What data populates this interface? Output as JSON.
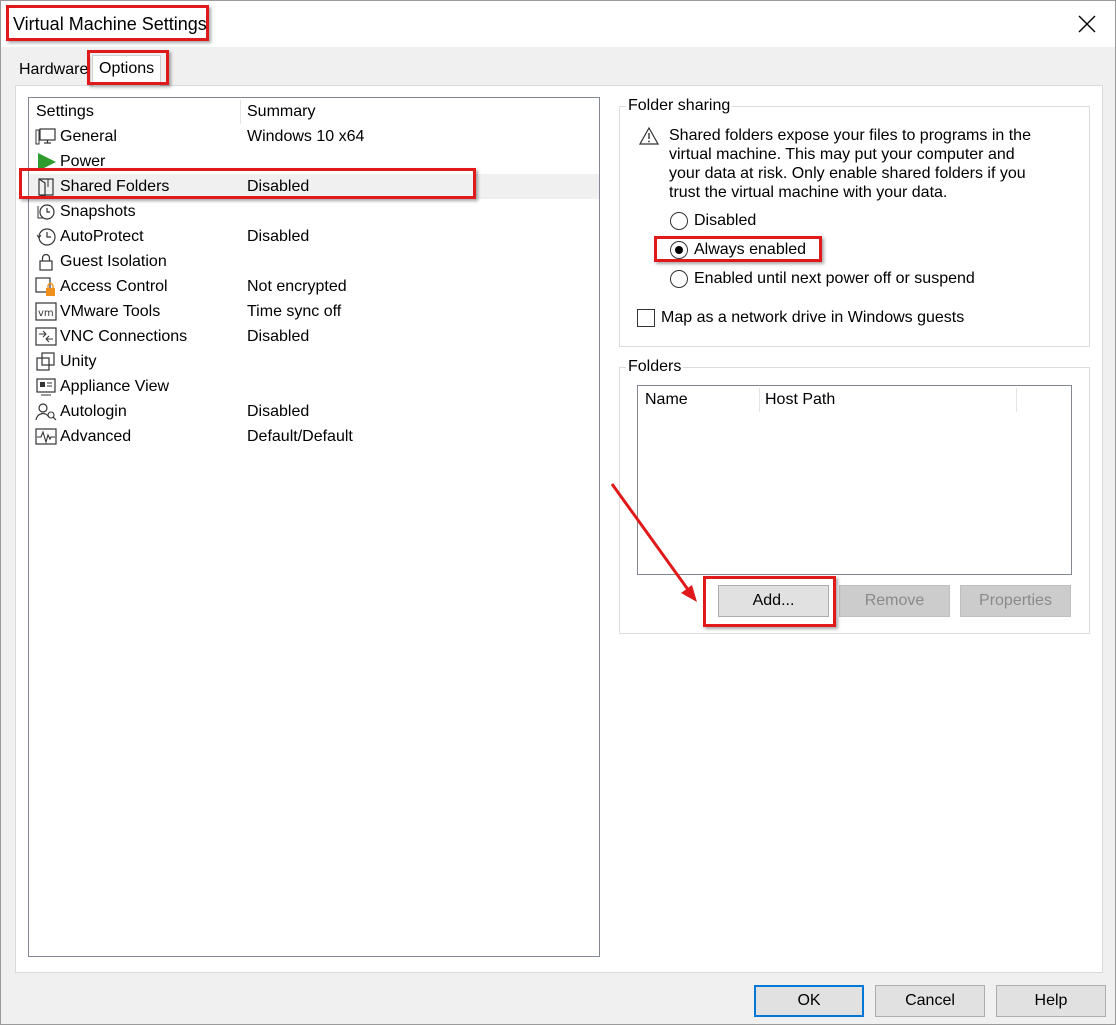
{
  "window": {
    "title": "Virtual Machine Settings"
  },
  "tabs": [
    {
      "label": "Hardware",
      "selected": false
    },
    {
      "label": "Options",
      "selected": true
    }
  ],
  "settings_list": {
    "columns": [
      "Settings",
      "Summary"
    ],
    "rows": [
      {
        "icon": "monitor-icon",
        "label": "General",
        "summary": "Windows 10 x64"
      },
      {
        "icon": "play-icon",
        "label": "Power",
        "summary": ""
      },
      {
        "icon": "shared-folder-icon",
        "label": "Shared Folders",
        "summary": "Disabled",
        "selected": true
      },
      {
        "icon": "snapshot-clock-icon",
        "label": "Snapshots",
        "summary": ""
      },
      {
        "icon": "history-icon",
        "label": "AutoProtect",
        "summary": "Disabled"
      },
      {
        "icon": "lock-icon",
        "label": "Guest Isolation",
        "summary": ""
      },
      {
        "icon": "access-control-icon",
        "label": "Access Control",
        "summary": "Not encrypted"
      },
      {
        "icon": "vm-icon",
        "label": "VMware Tools",
        "summary": "Time sync off"
      },
      {
        "icon": "vnc-icon",
        "label": "VNC Connections",
        "summary": "Disabled"
      },
      {
        "icon": "unity-icon",
        "label": "Unity",
        "summary": ""
      },
      {
        "icon": "appliance-icon",
        "label": "Appliance View",
        "summary": ""
      },
      {
        "icon": "autologin-icon",
        "label": "Autologin",
        "summary": "Disabled"
      },
      {
        "icon": "advanced-icon",
        "label": "Advanced",
        "summary": "Default/Default"
      }
    ]
  },
  "folder_sharing": {
    "title": "Folder sharing",
    "warning_icon": "warning-icon",
    "warning_lines": [
      "Shared folders expose your files to programs in the",
      "virtual machine. This may put your computer and",
      "your data at risk. Only enable shared folders if you",
      "trust the virtual machine with your data."
    ],
    "options": [
      {
        "label": "Disabled",
        "checked": false
      },
      {
        "label": "Always enabled",
        "checked": true
      },
      {
        "label": "Enabled until next power off or suspend",
        "checked": false
      }
    ],
    "map_drive_label": "Map as a network drive in Windows guests",
    "map_drive_checked": false
  },
  "folders": {
    "title": "Folders",
    "columns": [
      "Name",
      "Host Path"
    ],
    "buttons": {
      "add": "Add...",
      "remove": "Remove",
      "properties": "Properties"
    }
  },
  "footer": {
    "ok": "OK",
    "cancel": "Cancel",
    "help": "Help"
  },
  "colors": {
    "annotation": "#e01a1a",
    "accent": "#0078d7"
  }
}
